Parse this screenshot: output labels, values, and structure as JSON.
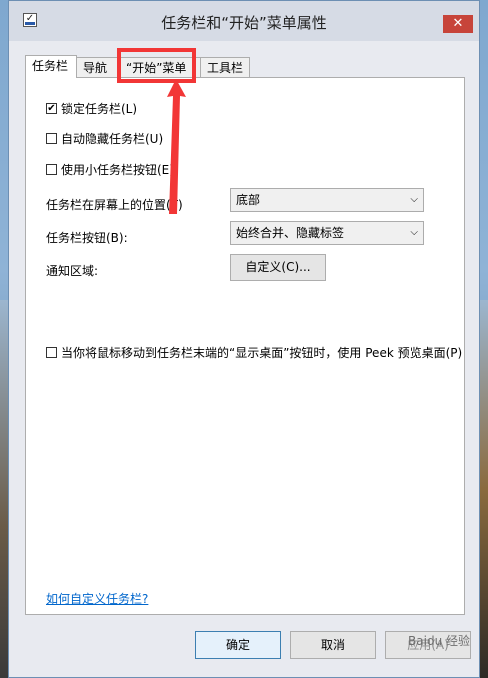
{
  "window": {
    "title": "任务栏和“开始”菜单属性",
    "close_symbol": "✕"
  },
  "tabs": [
    {
      "label": "任务栏",
      "active": true
    },
    {
      "label": "导航",
      "active": false
    },
    {
      "label": "“开始”菜单",
      "active": false
    },
    {
      "label": "工具栏",
      "active": false
    }
  ],
  "taskbar": {
    "lock_label": "锁定任务栏(L)",
    "lock_checked": true,
    "autohide_label": "自动隐藏任务栏(U)",
    "autohide_checked": false,
    "small_buttons_label": "使用小任务栏按钮(E)",
    "small_buttons_checked": false,
    "position_label": "任务栏在屏幕上的位置(T)",
    "position_value": "底部",
    "buttons_label": "任务栏按钮(B):",
    "buttons_value": "始终合并、隐藏标签",
    "notify_label": "通知区域:",
    "customize_label": "自定义(C)...",
    "peek_label": "当你将鼠标移动到任务栏末端的“显示桌面”按钮时，使用 Peek 预览桌面(P)",
    "peek_checked": false,
    "help_link": "如何自定义任务栏?"
  },
  "footer": {
    "ok_label": "确定",
    "cancel_label": "取消",
    "apply_label": "应用(A)"
  },
  "annotation": {
    "color": "#f23636"
  }
}
